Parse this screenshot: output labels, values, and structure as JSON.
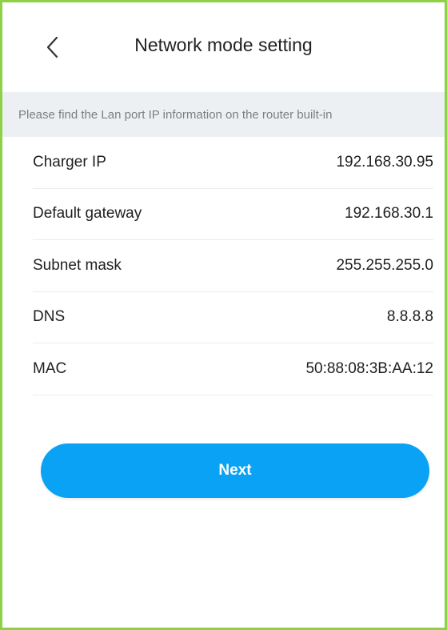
{
  "header": {
    "title": "Network mode setting",
    "back_icon": "chevron-left-icon"
  },
  "notice": {
    "text": "Please find the Lan port IP information on the router built-in"
  },
  "network_info": {
    "rows": [
      {
        "label": "Charger IP",
        "value": "192.168.30.95"
      },
      {
        "label": "Default gateway",
        "value": "192.168.30.1"
      },
      {
        "label": "Subnet mask",
        "value": "255.255.255.0"
      },
      {
        "label": "DNS",
        "value": "8.8.8.8"
      },
      {
        "label": "MAC",
        "value": "50:88:08:3B:AA:12"
      }
    ]
  },
  "actions": {
    "next_label": "Next"
  },
  "colors": {
    "accent": "#0aa2f4",
    "notice_background": "#edf0f2",
    "frame_border": "#8cd146"
  }
}
